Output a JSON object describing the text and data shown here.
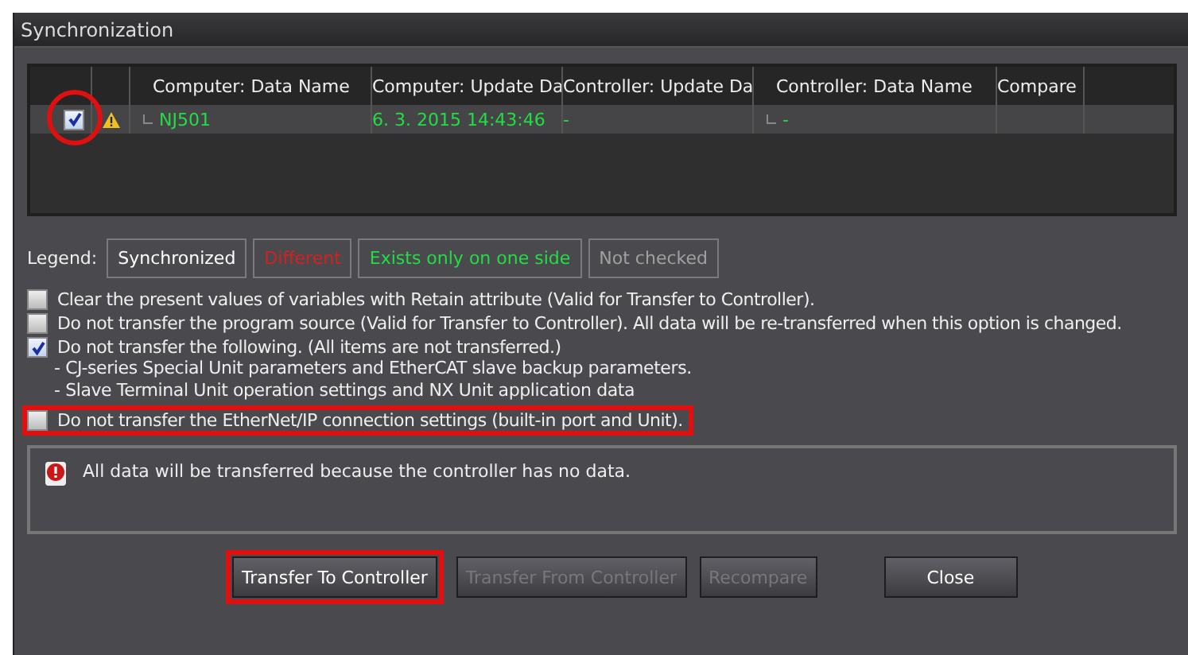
{
  "window": {
    "title": "Synchronization"
  },
  "table": {
    "columns": [
      "Computer: Data Name",
      "Computer: Update Da",
      "Controller: Update Da",
      "Controller: Data Name",
      "Compare"
    ],
    "rows": [
      {
        "checked": true,
        "warning": true,
        "highlighted": true,
        "cells": [
          "NJ501",
          "6. 3. 2015 14:43:46",
          "-",
          "-",
          ""
        ]
      }
    ]
  },
  "legend": {
    "label": "Legend:",
    "items": [
      {
        "label": "Synchronized",
        "color": "#ffffff"
      },
      {
        "label": "Different",
        "color": "#d42020"
      },
      {
        "label": "Exists only on one side",
        "color": "#22dd44"
      },
      {
        "label": "Not checked",
        "color": "#a0a0a0"
      }
    ]
  },
  "options": [
    {
      "label": "Clear the present values of variables with Retain attribute (Valid for Transfer to Controller).",
      "checked": false,
      "highlighted": false
    },
    {
      "label": "Do not transfer the program source (Valid for Transfer to Controller). All data will be re-transferred when this option is changed.",
      "checked": false,
      "highlighted": false
    },
    {
      "label": "Do not transfer the following. (All items are not transferred.)",
      "checked": true,
      "highlighted": false,
      "details": [
        "- CJ-series Special Unit parameters and EtherCAT slave backup parameters.",
        "- Slave Terminal Unit operation settings and NX Unit application data"
      ]
    },
    {
      "label": "Do not transfer the EtherNet/IP connection settings (built-in port and Unit).",
      "checked": false,
      "highlighted": true
    }
  ],
  "message": "All data will be transferred because the controller has no data.",
  "buttons": [
    {
      "label": "Transfer To Controller",
      "disabled": false,
      "highlighted": true
    },
    {
      "label": "Transfer From Controller",
      "disabled": true,
      "highlighted": false
    },
    {
      "label": "Recompare",
      "disabled": true,
      "highlighted": false
    },
    {
      "label": "Close",
      "disabled": false,
      "highlighted": false
    }
  ]
}
